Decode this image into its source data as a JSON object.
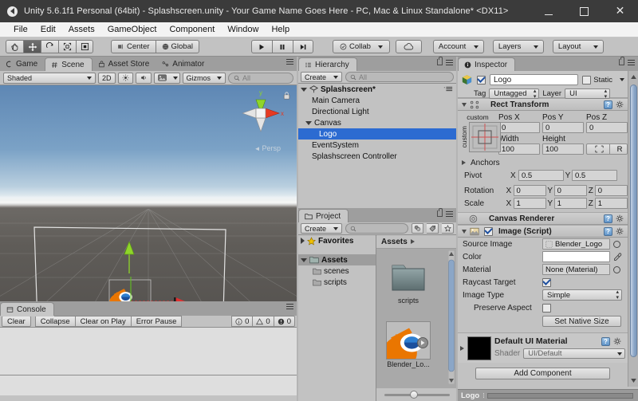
{
  "window": {
    "title": "Unity 5.6.1f1 Personal (64bit) - Splashscreen.unity - Your Game Name Goes Here - PC, Mac & Linux Standalone* <DX11>",
    "app_icon": "unity-icon",
    "minimize": "–",
    "maximize": "□",
    "close": "✕"
  },
  "menubar": {
    "items": [
      "File",
      "Edit",
      "Assets",
      "GameObject",
      "Component",
      "Window",
      "Help"
    ]
  },
  "toolbar": {
    "transform_tools": [
      {
        "name": "hand-tool",
        "glyph": "✋",
        "active": false
      },
      {
        "name": "move-tool",
        "glyph": "✥",
        "active": true
      },
      {
        "name": "rotate-tool",
        "glyph": "⟳",
        "active": false
      },
      {
        "name": "scale-tool",
        "glyph": "⤢",
        "active": false
      },
      {
        "name": "rect-tool",
        "glyph": "▣",
        "active": false
      }
    ],
    "pivot_label": "Center",
    "space_label": "Global",
    "play": "▶",
    "pause": "❙❙",
    "step": "▶❙",
    "collab_label": "Collab",
    "cloud_label": "cloud-icon",
    "account_label": "Account",
    "layers_label": "Layers",
    "layout_label": "Layout"
  },
  "scene_panel": {
    "tabs": [
      {
        "label": "Game",
        "icon": "game-icon",
        "active": false
      },
      {
        "label": "Scene",
        "icon": "scene-icon",
        "active": true
      },
      {
        "label": "Asset Store",
        "icon": "store-icon",
        "active": false
      },
      {
        "label": "Animator",
        "icon": "animator-icon",
        "active": false
      }
    ],
    "shading_mode": "Shaded",
    "view_2d": "2D",
    "lighting_icon": "sun-icon",
    "audio_icon": "speaker-icon",
    "effects_icon": "image-icon",
    "gizmos_label": "Gizmos",
    "search_placeholder": "All",
    "search_value": "",
    "perspective_label": "Persp",
    "axis_labels": {
      "y": "y",
      "x": "x"
    }
  },
  "console_panel": {
    "tab_label": "Console",
    "tab_icon": "console-icon",
    "buttons": [
      "Clear",
      "Collapse",
      "Clear on Play",
      "Error Pause"
    ],
    "counts": [
      {
        "icon": "info-icon",
        "value": "0"
      },
      {
        "icon": "warning-icon",
        "value": "0"
      },
      {
        "icon": "error-icon",
        "value": "0"
      }
    ]
  },
  "hierarchy_panel": {
    "tab_label": "Hierarchy",
    "tab_icon": "hierarchy-icon",
    "create_label": "Create",
    "search_placeholder": "All",
    "search_value": "",
    "tree": [
      {
        "label": "Splashscreen*",
        "depth": 0,
        "expanded": true,
        "bold": true,
        "selected": false,
        "icon": "scene-icon"
      },
      {
        "label": "Main Camera",
        "depth": 1,
        "expanded": null,
        "bold": false,
        "selected": false,
        "icon": ""
      },
      {
        "label": "Directional Light",
        "depth": 1,
        "expanded": null,
        "bold": false,
        "selected": false,
        "icon": ""
      },
      {
        "label": "Canvas",
        "depth": 1,
        "expanded": true,
        "bold": false,
        "selected": false,
        "icon": ""
      },
      {
        "label": "Logo",
        "depth": 2,
        "expanded": null,
        "bold": false,
        "selected": true,
        "icon": ""
      },
      {
        "label": "EventSystem",
        "depth": 1,
        "expanded": null,
        "bold": false,
        "selected": false,
        "icon": ""
      },
      {
        "label": "Splashscreen Controller",
        "depth": 1,
        "expanded": null,
        "bold": false,
        "selected": false,
        "icon": ""
      }
    ]
  },
  "project_panel": {
    "tab_label": "Project",
    "tab_icon": "folder-icon",
    "create_label": "Create",
    "search_placeholder": "",
    "search_value": "",
    "icon_buttons": [
      "filter-by-type-icon",
      "filter-by-label-icon",
      "favorite-star-icon"
    ],
    "tree": [
      {
        "label": "Favorites",
        "depth": 0,
        "expanded": false,
        "icon": "star-icon",
        "selected": false
      },
      {
        "label": "Assets",
        "depth": 0,
        "expanded": true,
        "icon": "folder-icon",
        "selected": true
      },
      {
        "label": "scenes",
        "depth": 1,
        "expanded": null,
        "icon": "folder-icon",
        "selected": false
      },
      {
        "label": "scripts",
        "depth": 1,
        "expanded": null,
        "icon": "folder-icon",
        "selected": false
      }
    ],
    "breadcrumb": [
      "Assets"
    ],
    "assets": [
      {
        "label": "scripts",
        "type": "folder",
        "selected": false
      },
      {
        "label": "Blender_Lo...",
        "type": "image",
        "selected": true
      }
    ]
  },
  "inspector_panel": {
    "tab_label": "Inspector",
    "tab_icon": "info-icon",
    "object_name": "Logo",
    "object_enabled": true,
    "static_label": "Static",
    "static_checked": false,
    "tag_label": "Tag",
    "tag_value": "Untagged",
    "layer_label": "Layer",
    "layer_value": "UI",
    "rect_transform": {
      "title": "Rect Transform",
      "anchor_preset": "custom",
      "anchor_axis_label": "custom",
      "pos_x_label": "Pos X",
      "pos_x": "0",
      "pos_y_label": "Pos Y",
      "pos_y": "0",
      "pos_z_label": "Pos Z",
      "pos_z": "0",
      "width_label": "Width",
      "width": "100",
      "height_label": "Height",
      "height": "100",
      "blueprint_button": "blueprint-icon",
      "raw_button": "R",
      "anchors_label": "Anchors",
      "pivot_label": "Pivot",
      "pivot_x": "0.5",
      "pivot_y": "0.5",
      "rotation_label": "Rotation",
      "rot_x": "0",
      "rot_y": "0",
      "rot_z": "0",
      "scale_label": "Scale",
      "scale_x": "1",
      "scale_y": "1",
      "scale_z": "1",
      "axis_x": "X",
      "axis_y": "Y",
      "axis_z": "Z"
    },
    "canvas_renderer": {
      "title": "Canvas Renderer"
    },
    "image_script": {
      "title": "Image (Script)",
      "enabled": true,
      "source_image_label": "Source Image",
      "source_image_value": "Blender_Logo",
      "color_label": "Color",
      "color_value": "#FFFFFF",
      "material_label": "Material",
      "material_value": "None (Material)",
      "raycast_target_label": "Raycast Target",
      "raycast_target_checked": true,
      "image_type_label": "Image Type",
      "image_type_value": "Simple",
      "preserve_aspect_label": "Preserve Aspect",
      "preserve_aspect_checked": false,
      "set_native_size_label": "Set Native Size"
    },
    "material_block": {
      "title": "Default UI Material",
      "shader_label": "Shader",
      "shader_value": "UI/Default",
      "swatch_color": "#000000"
    },
    "add_component_label": "Add Component",
    "footer_label": "Logo"
  },
  "colors": {
    "toolbar_bg": "#c2c2c2",
    "panel_bg": "#c2c2c2",
    "titlebar_bg": "#3b3b3b",
    "selection_blue": "#2c6bd1",
    "scrollbar_blue": "#8ba6c7",
    "blender_orange": "#ea7600"
  }
}
